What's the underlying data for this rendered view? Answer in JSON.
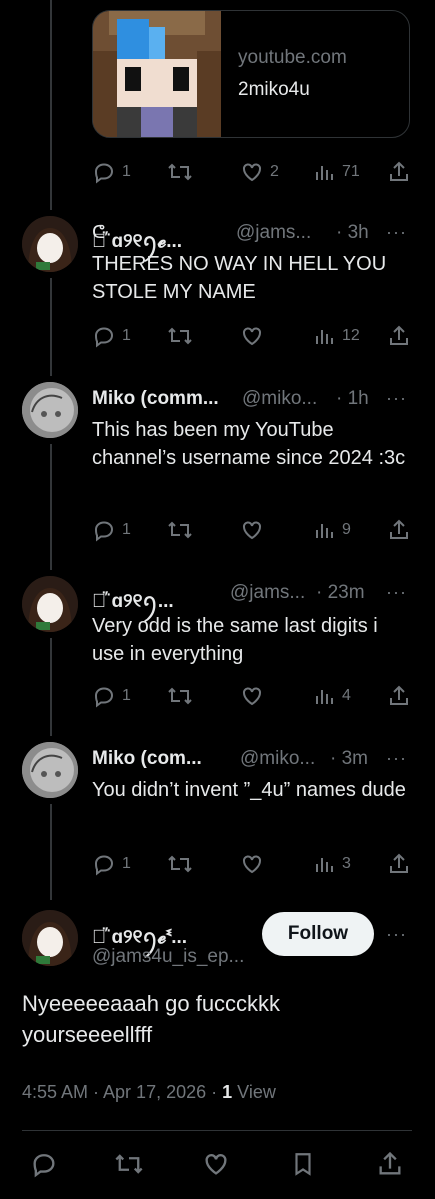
{
  "link_card": {
    "domain": "youtube.com",
    "title": "2miko4u"
  },
  "top_actions": {
    "replies": "1",
    "likes": "2",
    "views": "71"
  },
  "replies": [
    {
      "name": "ᕦ᷁  ɑ୨୧ꪆ𝓮...",
      "handle": "@jams...",
      "time": "· 3h",
      "text": "THERES NO WAY IN HELL YOU STOLE MY NAME",
      "replies": "1",
      "likes": "",
      "views": "12"
    },
    {
      "name": "Miko (comm...",
      "handle": "@miko...",
      "time": "· 1h",
      "text": "This has been my YouTube channel’s username since 2024 :3c",
      "replies": "1",
      "likes": "",
      "views": "9"
    },
    {
      "name": "ᕦ᷁  ɑ୨୧ꪆ...",
      "handle": "@jams...",
      "time": "· 23m",
      "text": "Very odd is the same last digits i use in everything",
      "replies": "1",
      "likes": "",
      "views": "4"
    },
    {
      "name": "Miko (com...",
      "handle": "@miko...",
      "time": "· 3m",
      "text": "You didn’t invent ”_4u” names dude",
      "replies": "1",
      "likes": "",
      "views": "3"
    }
  ],
  "main_post": {
    "name": "ᕦ᷁  ɑ୨୧ꪆ𝓮ᓫ...",
    "handle": "@jams4u_is_ep...",
    "follow_label": "Follow",
    "text": "Nyeeeeeaaah go fuccckkk yourseeeellfff",
    "time": "4:55 AM · Apr 17, 2026 · ",
    "views_count": "1",
    "views_label": " View"
  },
  "more_label": "···",
  "colors": {
    "background": "#000000",
    "text": "#e7e9ea",
    "muted": "#71767b",
    "border": "#2f3336"
  },
  "icons": [
    "reply-icon",
    "retweet-icon",
    "like-icon",
    "views-icon",
    "share-icon",
    "bookmark-icon",
    "more-icon"
  ]
}
